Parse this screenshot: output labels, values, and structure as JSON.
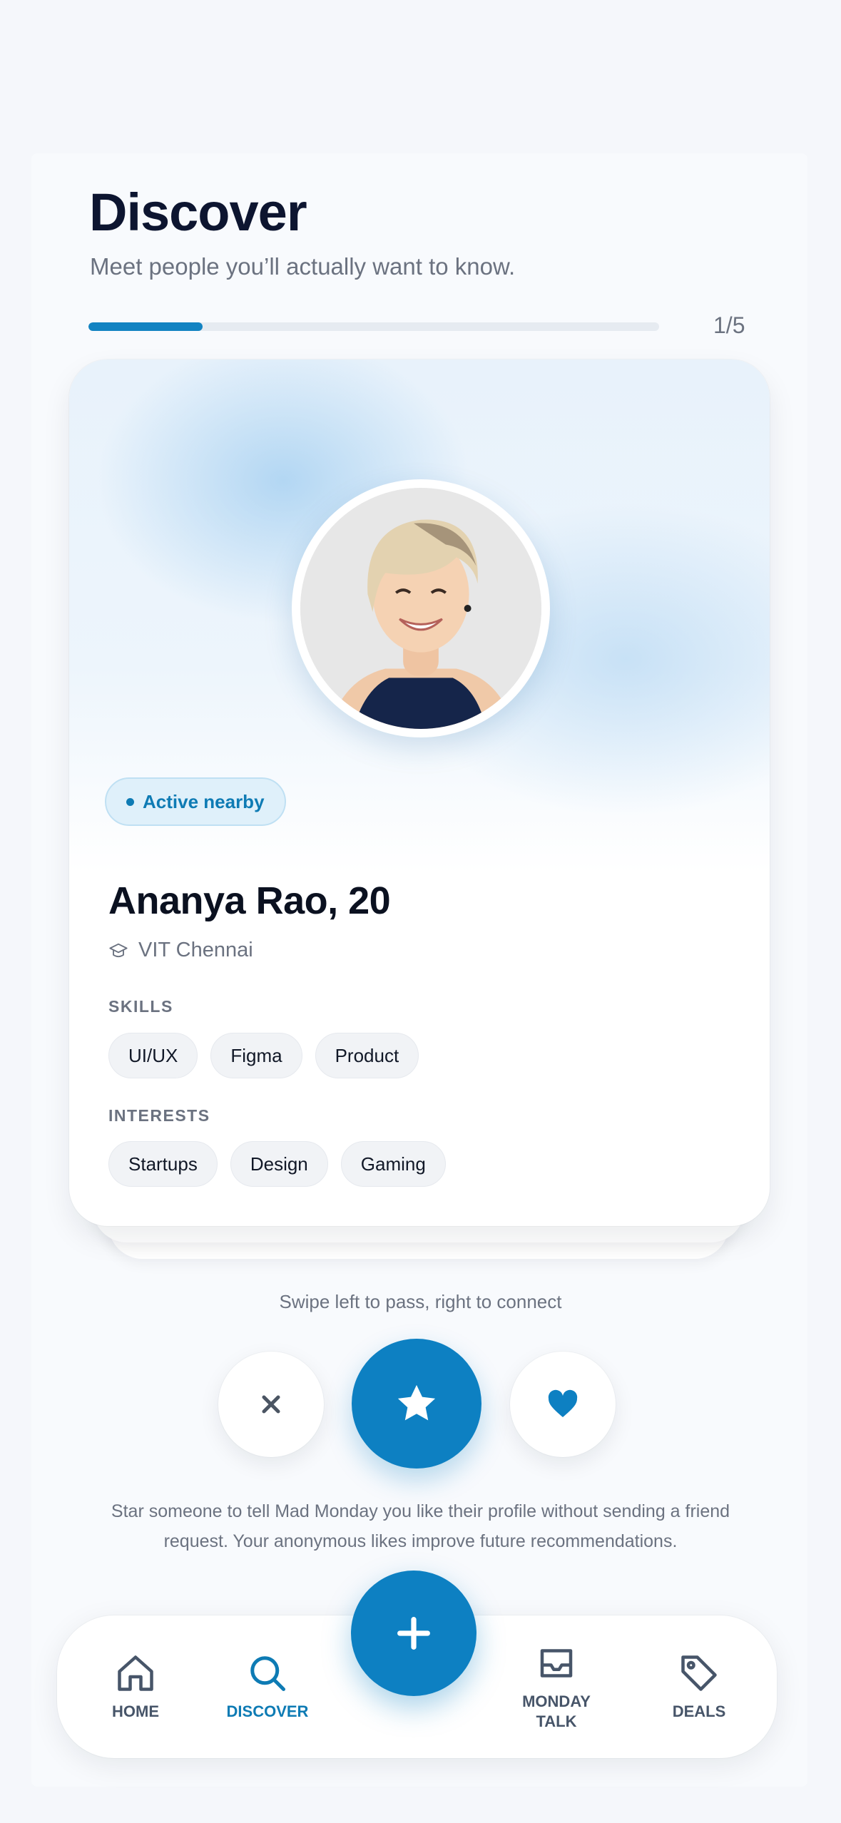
{
  "header": {
    "title": "Discover",
    "subtitle": "Meet people you’ll actually want to know.",
    "progress_label": "1/5",
    "progress_fraction": 0.2
  },
  "profile": {
    "status_badge": "Active nearby",
    "name": "Ananya Rao, 20",
    "school": "VIT Chennai",
    "skills_label": "SKILLS",
    "skills": [
      "UI/UX",
      "Figma",
      "Product"
    ],
    "interests_label": "INTERESTS",
    "interests": [
      "Startups",
      "Design",
      "Gaming"
    ]
  },
  "actions": {
    "hint": "Swipe left to pass, right to connect",
    "pass_icon": "close-icon",
    "star_icon": "star-icon",
    "like_icon": "heart-icon",
    "star_note": "Star someone to tell Mad Monday you like their profile without sending a friend request. Your anonymous likes improve future recommendations."
  },
  "nav": {
    "home": "HOME",
    "discover": "DISCOVER",
    "talk_line1": "MONDAY",
    "talk_line2": "TALK",
    "deals": "DEALS",
    "fab_icon": "plus-icon"
  },
  "colors": {
    "accent": "#0d80c2",
    "accent_text": "#0e7bb4",
    "muted_text": "#6b7280"
  }
}
